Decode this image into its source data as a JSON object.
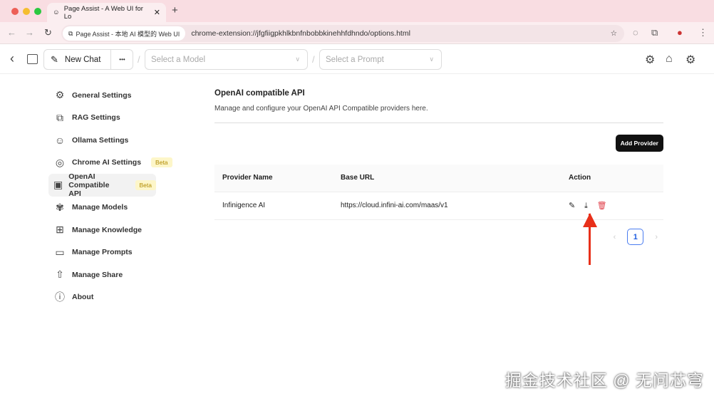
{
  "browser": {
    "tab_title": "Page Assist - A Web UI for Lo",
    "url_chip": "Page Assist - 本地 AI 模型的 Web UI",
    "url": "chrome-extension://jfgfiigpkhlkbnfnbobbkinehhfdhndo/options.html"
  },
  "appbar": {
    "new_chat": "New Chat",
    "more": "•••",
    "model_placeholder": "Select a Model",
    "prompt_placeholder": "Select a Prompt"
  },
  "sidebar": {
    "items": [
      {
        "label": "General Settings",
        "icon": "⚙"
      },
      {
        "label": "RAG Settings",
        "icon": "⧉"
      },
      {
        "label": "Ollama Settings",
        "icon": "☺"
      },
      {
        "label": "Chrome AI Settings",
        "icon": "◎",
        "badge": "Beta"
      },
      {
        "label": "OpenAI Compatible API",
        "icon": "▣",
        "badge": "Beta"
      },
      {
        "label": "Manage Models",
        "icon": "✾"
      },
      {
        "label": "Manage Knowledge",
        "icon": "⊞"
      },
      {
        "label": "Manage Prompts",
        "icon": "▭"
      },
      {
        "label": "Manage Share",
        "icon": "⇧"
      },
      {
        "label": "About",
        "icon": "ⓘ"
      }
    ]
  },
  "main": {
    "title": "OpenAI compatible API",
    "description": "Manage and configure your OpenAI API Compatible providers here.",
    "add_button": "Add Provider",
    "columns": [
      "Provider Name",
      "Base URL",
      "Action"
    ],
    "rows": [
      {
        "name": "Infinigence AI",
        "url": "https://cloud.infini-ai.com/maas/v1"
      }
    ],
    "page": "1"
  },
  "watermark": "掘金技术社区 @ 无问芯穹"
}
